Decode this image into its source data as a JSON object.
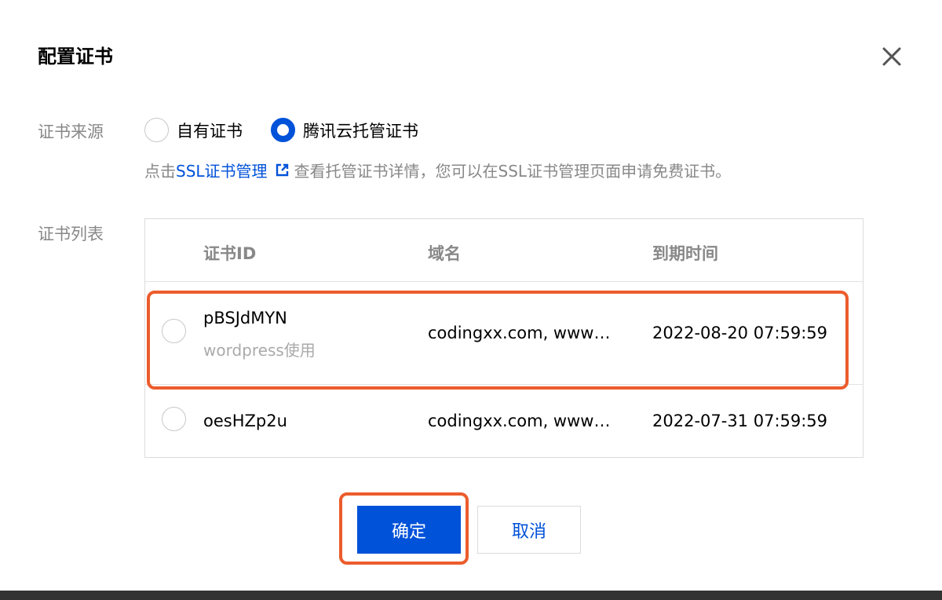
{
  "dialog": {
    "title": "配置证书",
    "close_icon": "close-icon"
  },
  "source": {
    "label": "证书来源",
    "options": [
      {
        "label": "自有证书",
        "checked": false
      },
      {
        "label": "腾讯云托管证书",
        "checked": true
      }
    ],
    "hint": {
      "prefix": "点击",
      "link": "SSL证书管理",
      "link_icon": "external-link-icon",
      "suffix": "查看托管证书详情，您可以在SSL证书管理页面申请免费证书。"
    }
  },
  "cert_list": {
    "label": "证书列表",
    "columns": [
      "证书ID",
      "域名",
      "到期时间"
    ],
    "rows": [
      {
        "id": "pBSJdMYN",
        "remark": "wordpress使用",
        "domain": "codingxx.com, www…",
        "expires": "2022-08-20 07:59:59",
        "selected": false
      },
      {
        "id": "oesHZp2u",
        "remark": "",
        "domain": "codingxx.com, www…",
        "expires": "2022-07-31 07:59:59",
        "selected": false
      }
    ]
  },
  "footer": {
    "confirm_label": "确定",
    "cancel_label": "取消"
  },
  "colors": {
    "primary": "#0052d9",
    "highlight": "#ec5c2c",
    "muted_text": "#888888"
  }
}
